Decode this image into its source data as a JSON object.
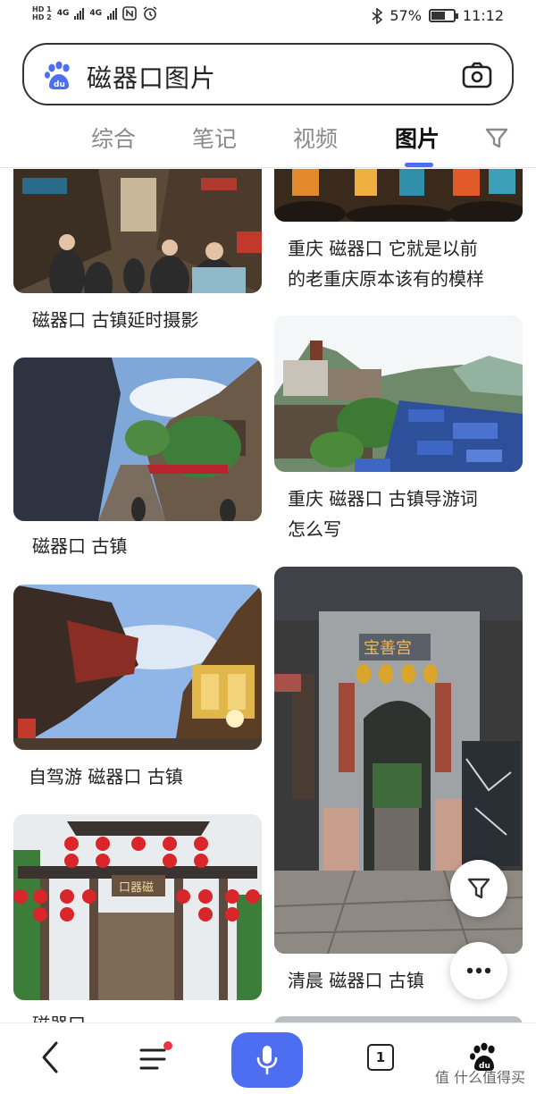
{
  "status_bar": {
    "hd1": "HD 1",
    "hd2": "HD 2",
    "net1": "4G",
    "net2": "4G",
    "battery_percent_text": "57%",
    "battery_level": 0.57,
    "time": "11:12"
  },
  "search": {
    "query": "磁器口图片"
  },
  "tabs": [
    {
      "label": "综合"
    },
    {
      "label": "笔记"
    },
    {
      "label": "视频"
    },
    {
      "label": "图片"
    }
  ],
  "results": {
    "left": [
      {
        "caption": "磁器口 古镇延时摄影"
      },
      {
        "caption": "磁器口 古镇"
      },
      {
        "caption": "自驾游 磁器口 古镇"
      },
      {
        "caption": "磁器口"
      }
    ],
    "right": [
      {
        "caption_line1": "重庆 磁器口 它就是以前",
        "caption_line2": "的老重庆原本该有的模样"
      },
      {
        "caption_line1": "重庆 磁器口 古镇导游词",
        "caption_line2": "怎么写"
      },
      {
        "caption": "清晨 磁器口 古镇"
      }
    ]
  },
  "bottom_nav": {
    "page_count": "1"
  },
  "watermark": "值 什么值得买",
  "colors": {
    "accent": "#4e6ef2",
    "badge": "#ee3344"
  }
}
